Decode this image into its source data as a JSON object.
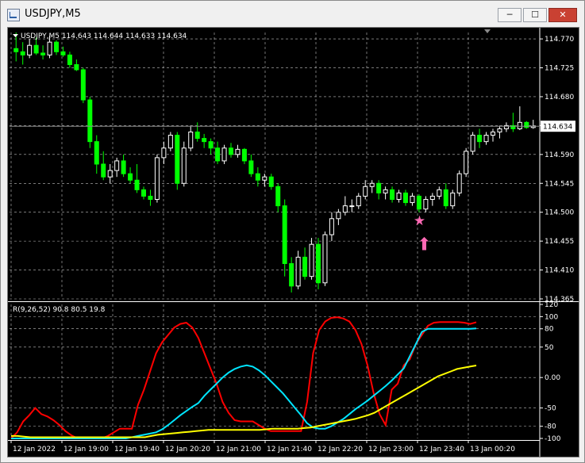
{
  "window": {
    "title": "USDJPY,M5",
    "minimize_glyph": "─",
    "maximize_glyph": "☐",
    "close_glyph": "✕"
  },
  "colors": {
    "background": "#000000",
    "candle_up": "#ffffff",
    "candle_down": "#00ff00",
    "grid": "#ffffff",
    "price_line": "#8a8a8a",
    "red_line": "#ff0000",
    "cyan_line": "#00e5ff",
    "yellow_line": "#ffff00",
    "marker": "#ff69b4"
  },
  "main_chart": {
    "header": "USDJPY,M5  114.643 114.644 114.633 114.634",
    "header_marker_icon": "triangle-down-icon",
    "current_price_label": "114.634",
    "y_ticks": [
      "114.770",
      "114.725",
      "114.680",
      "114.635",
      "114.590",
      "114.545",
      "114.500",
      "114.455",
      "114.410",
      "114.365"
    ],
    "markers": [
      {
        "name": "star-marker",
        "glyph": "★",
        "price": 114.487,
        "bar_index": 60
      },
      {
        "name": "up-arrow-marker",
        "glyph": "⬆",
        "price": 114.458,
        "bar_index": 61
      }
    ]
  },
  "indicator": {
    "header": "R(9,26,52) 90.8 80.5 19.8",
    "y_ticks": [
      "120",
      "100",
      "80",
      "50",
      "0.00",
      "-50",
      "-80",
      "-100"
    ]
  },
  "x_axis": {
    "labels": [
      "12 Jan 2022",
      "12 Jan 19:00",
      "12 Jan 19:40",
      "12 Jan 20:20",
      "12 Jan 21:00",
      "12 Jan 21:40",
      "12 Jan 22:20",
      "12 Jan 23:00",
      "12 Jan 23:40",
      "13 Jan 00:20"
    ]
  },
  "chart_data": [
    {
      "type": "candlestick",
      "symbol": "USDJPY",
      "timeframe": "M5",
      "ylim": [
        114.365,
        114.78
      ],
      "close_last": 114.634,
      "candles": [
        [
          114.755,
          114.78,
          114.735,
          114.75
        ],
        [
          114.75,
          114.765,
          114.73,
          114.745
        ],
        [
          114.745,
          114.77,
          114.74,
          114.76
        ],
        [
          114.76,
          114.772,
          114.745,
          114.748
        ],
        [
          114.748,
          114.76,
          114.738,
          114.745
        ],
        [
          114.745,
          114.775,
          114.74,
          114.765
        ],
        [
          114.765,
          114.768,
          114.745,
          114.75
        ],
        [
          114.75,
          114.758,
          114.742,
          114.745
        ],
        [
          114.745,
          114.75,
          114.725,
          114.73
        ],
        [
          114.73,
          114.738,
          114.72,
          114.722
        ],
        [
          114.722,
          114.725,
          114.67,
          114.675
        ],
        [
          114.675,
          114.68,
          114.6,
          114.61
        ],
        [
          114.61,
          114.62,
          114.56,
          114.575
        ],
        [
          114.575,
          114.595,
          114.55,
          114.555
        ],
        [
          114.555,
          114.575,
          114.545,
          114.565
        ],
        [
          114.565,
          114.585,
          114.555,
          114.58
        ],
        [
          114.58,
          114.59,
          114.555,
          114.56
        ],
        [
          114.56,
          114.57,
          114.545,
          114.55
        ],
        [
          114.55,
          114.575,
          114.53,
          114.535
        ],
        [
          114.535,
          114.54,
          114.52,
          114.525
        ],
        [
          114.525,
          114.535,
          114.51,
          114.52
        ],
        [
          114.52,
          114.59,
          114.515,
          114.585
        ],
        [
          114.585,
          114.61,
          114.575,
          114.6
        ],
        [
          114.6,
          114.625,
          114.595,
          114.62
        ],
        [
          114.62,
          114.625,
          114.535,
          114.545
        ],
        [
          114.545,
          114.61,
          114.54,
          114.6
        ],
        [
          114.6,
          114.635,
          114.595,
          114.625
        ],
        [
          114.625,
          114.64,
          114.61,
          114.615
        ],
        [
          114.615,
          114.622,
          114.6,
          114.61
        ],
        [
          114.61,
          114.615,
          114.59,
          114.6
        ],
        [
          114.6,
          114.61,
          114.575,
          114.58
        ],
        [
          114.58,
          114.605,
          114.575,
          114.6
        ],
        [
          114.6,
          114.608,
          114.585,
          114.59
        ],
        [
          114.59,
          114.605,
          114.585,
          114.598
        ],
        [
          114.598,
          114.6,
          114.575,
          114.58
        ],
        [
          114.58,
          114.59,
          114.555,
          114.56
        ],
        [
          114.56,
          114.57,
          114.54,
          114.55
        ],
        [
          114.55,
          114.56,
          114.54,
          114.555
        ],
        [
          114.555,
          114.56,
          114.535,
          114.54
        ],
        [
          114.54,
          114.545,
          114.5,
          114.51
        ],
        [
          114.51,
          114.52,
          114.4,
          114.42
        ],
        [
          114.42,
          114.43,
          114.375,
          114.385
        ],
        [
          114.385,
          114.44,
          114.38,
          114.43
        ],
        [
          114.43,
          114.445,
          114.395,
          114.4
        ],
        [
          114.4,
          114.46,
          114.395,
          114.45
        ],
        [
          114.45,
          114.46,
          114.38,
          114.39
        ],
        [
          114.39,
          114.47,
          114.385,
          114.465
        ],
        [
          114.465,
          114.5,
          114.455,
          114.49
        ],
        [
          114.49,
          114.505,
          114.48,
          114.5
        ],
        [
          114.5,
          114.525,
          114.495,
          114.51
        ],
        [
          114.51,
          114.52,
          114.5,
          114.51
        ],
        [
          114.51,
          114.53,
          114.505,
          114.525
        ],
        [
          114.525,
          114.55,
          114.52,
          114.54
        ],
        [
          114.54,
          114.55,
          114.53,
          114.545
        ],
        [
          114.545,
          114.55,
          114.52,
          114.53
        ],
        [
          114.53,
          114.54,
          114.52,
          114.535
        ],
        [
          114.535,
          114.54,
          114.515,
          114.52
        ],
        [
          114.52,
          114.535,
          114.515,
          114.53
        ],
        [
          114.53,
          114.535,
          114.51,
          114.515
        ],
        [
          114.515,
          114.53,
          114.51,
          114.525
        ],
        [
          114.525,
          114.528,
          114.5,
          114.505
        ],
        [
          114.505,
          114.525,
          114.5,
          114.52
        ],
        [
          114.52,
          114.53,
          114.51,
          114.525
        ],
        [
          114.525,
          114.54,
          114.52,
          114.535
        ],
        [
          114.535,
          114.545,
          114.505,
          114.51
        ],
        [
          114.51,
          114.535,
          114.505,
          114.53
        ],
        [
          114.53,
          114.565,
          114.525,
          114.56
        ],
        [
          114.56,
          114.6,
          114.555,
          114.595
        ],
        [
          114.595,
          114.625,
          114.59,
          114.62
        ],
        [
          114.62,
          114.63,
          114.6,
          114.61
        ],
        [
          114.61,
          114.625,
          114.605,
          114.62
        ],
        [
          114.62,
          114.63,
          114.61,
          114.625
        ],
        [
          114.625,
          114.635,
          114.615,
          114.63
        ],
        [
          114.63,
          114.64,
          114.625,
          114.635
        ],
        [
          114.635,
          114.655,
          114.625,
          114.63
        ],
        [
          114.63,
          114.665,
          114.628,
          114.64
        ],
        [
          114.64,
          114.642,
          114.63,
          114.632
        ],
        [
          114.632,
          114.644,
          114.63,
          114.634
        ]
      ]
    },
    {
      "type": "line",
      "title": "R(9,26,52)",
      "ylim": [
        -100,
        120
      ],
      "series": [
        {
          "name": "R(9)",
          "color": "#ff0000",
          "last": 90.8,
          "values": [
            -100,
            -90,
            -72,
            -62,
            -50,
            -60,
            -64,
            -70,
            -78,
            -88,
            -95,
            -100,
            -100,
            -100,
            -100,
            -100,
            -96,
            -90,
            -84,
            -84,
            -84,
            -45,
            -20,
            10,
            40,
            58,
            70,
            82,
            88,
            90,
            82,
            65,
            40,
            15,
            -10,
            -40,
            -58,
            -70,
            -72,
            -72,
            -72,
            -78,
            -84,
            -88,
            -88,
            -88,
            -88,
            -88,
            -88,
            -40,
            40,
            78,
            92,
            98,
            99,
            97,
            92,
            78,
            55,
            20,
            -25,
            -60,
            -78,
            -20,
            -10,
            20,
            30,
            55,
            70,
            85,
            90,
            91,
            91,
            91,
            91,
            90,
            88,
            90.8
          ]
        },
        {
          "name": "R(26)",
          "color": "#00e5ff",
          "last": 80.5,
          "values": [
            -100,
            -100,
            -100,
            -100,
            -100,
            -100,
            -100,
            -100,
            -100,
            -100,
            -100,
            -100,
            -100,
            -100,
            -100,
            -100,
            -100,
            -100,
            -100,
            -100,
            -98,
            -96,
            -94,
            -92,
            -90,
            -85,
            -78,
            -70,
            -62,
            -55,
            -48,
            -42,
            -30,
            -20,
            -10,
            0,
            8,
            14,
            18,
            20,
            18,
            12,
            4,
            -6,
            -16,
            -26,
            -38,
            -50,
            -62,
            -75,
            -82,
            -84,
            -84,
            -80,
            -74,
            -68,
            -60,
            -52,
            -45,
            -38,
            -30,
            -22,
            -14,
            -5,
            5,
            15,
            35,
            55,
            75,
            80,
            80,
            80,
            80,
            80,
            80,
            80,
            80,
            80.5
          ]
        },
        {
          "name": "R(52)",
          "color": "#ffff00",
          "last": 19.8,
          "values": [
            -96,
            -96,
            -97,
            -98,
            -98,
            -98,
            -98,
            -98,
            -98,
            -98,
            -98,
            -98,
            -98,
            -98,
            -98,
            -98,
            -98,
            -98,
            -98,
            -98,
            -98,
            -98,
            -96,
            -94,
            -93,
            -92,
            -91,
            -90,
            -89,
            -88,
            -87,
            -86,
            -86,
            -86,
            -86,
            -86,
            -86,
            -86,
            -86,
            -86,
            -85,
            -84,
            -84,
            -84,
            -84,
            -84,
            -83,
            -82,
            -80,
            -78,
            -76,
            -74,
            -72,
            -70,
            -68,
            -65,
            -62,
            -58,
            -52,
            -46,
            -40,
            -34,
            -28,
            -22,
            -16,
            -10,
            -4,
            2,
            6,
            10,
            14,
            16,
            18,
            19.8
          ]
        }
      ]
    }
  ]
}
